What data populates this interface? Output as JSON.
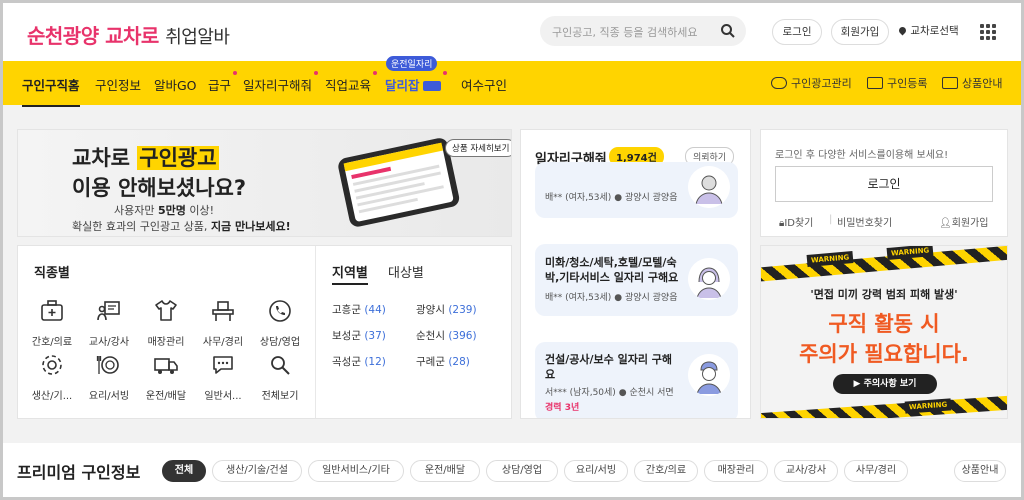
{
  "header": {
    "logo_main": "순천광양 교차로",
    "logo_sub": "취업알바",
    "search_placeholder": "구인공고, 직종 등을 검색하세요",
    "login": "로그인",
    "signup": "회원가입",
    "region_select": "교차로선택"
  },
  "nav": {
    "items": [
      "구인구직홈",
      "구인정보",
      "알바GO",
      "급구",
      "일자리구해줘",
      "직업교육",
      "달리잡",
      "여수구인"
    ],
    "badge": "운전일자리",
    "right": [
      "구인광고관리",
      "구인등록",
      "상품안내"
    ]
  },
  "banner": {
    "title_a": "교차로",
    "title_b": "구인광고",
    "title_2": "이용 안해보셨나요?",
    "sub1_pre": "사용자만",
    "sub1_bold": "5만명",
    "sub1_post": "이상!",
    "sub2_pre": "확실한 효과의 구인광고 상품,",
    "sub2_bold": "지금 만나보세요!",
    "detail_button": "상품 자세히보기"
  },
  "category": {
    "job_tab": "직종별",
    "jobs": [
      "간호/의료",
      "교사/강사",
      "매장관리",
      "사무/경리",
      "상담/영업",
      "생산/기...",
      "요리/서빙",
      "운전/배달",
      "일반서...",
      "전체보기"
    ],
    "job_icons": [
      "medical-kit-icon",
      "teacher-icon",
      "shirt-icon",
      "office-icon",
      "phone-icon",
      "gear-icon",
      "dining-icon",
      "truck-icon",
      "chat-icon",
      "magnifier-icon"
    ],
    "region_tab": "지역별",
    "target_tab": "대상별",
    "regions": [
      {
        "name": "고흥군",
        "count": "(44)"
      },
      {
        "name": "광양시",
        "count": "(239)"
      },
      {
        "name": "보성군",
        "count": "(37)"
      },
      {
        "name": "순천시",
        "count": "(396)"
      },
      {
        "name": "곡성군",
        "count": "(12)"
      },
      {
        "name": "구례군",
        "count": "(28)"
      }
    ]
  },
  "jobs_panel": {
    "title": "일자리구해줘",
    "count": "1,974건",
    "request": "의뢰하기",
    "cards": [
      {
        "title": "",
        "meta": "배** (여자,53세)",
        "location": "광양시 광양읍"
      },
      {
        "title": "미화/청소/세탁,호텔/모텔/숙박,기타서비스 일자리 구해요",
        "meta": "배** (여자,53세)",
        "location": "광양시 광양읍"
      },
      {
        "title": "건설/공사/보수 일자리 구해요",
        "meta": "서*** (남자,50세)",
        "location": "순천시 서면",
        "extra": "경력 3년"
      }
    ]
  },
  "login_panel": {
    "desc": "로그인 후 다양한 서비스를이용해 보세요!",
    "button": "로그인",
    "find_id": "ID찾기",
    "find_pw": "비밀번호찾기",
    "join": "회원가입"
  },
  "warning_ad": {
    "tape": "WARNING",
    "quote": "'면접 미끼 강력 범죄 피해 발생'",
    "line1": "구직 활동 시",
    "line2": "주의가 필요합니다.",
    "button": "주의사항 보기"
  },
  "premium": {
    "title": "프리미엄 구인정보",
    "chips": [
      "전체",
      "생산/기술/건설",
      "일반서비스/기타",
      "운전/배달",
      "상담/영업",
      "요리/서빙",
      "간호/의료",
      "매장관리",
      "교사/강사",
      "사무/경리"
    ],
    "product_info": "상품안내"
  },
  "colors": {
    "brand_pink": "#e8336b",
    "nav_yellow": "#ffd400",
    "accent_blue": "#3d5bd9",
    "warning_orange": "#f05a22"
  }
}
